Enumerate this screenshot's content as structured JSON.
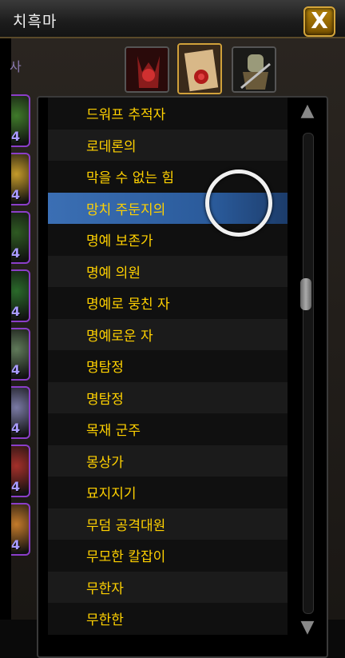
{
  "window": {
    "title": "치흑마",
    "close_label": "X"
  },
  "left_partial_char": "사",
  "slots": [
    {
      "num": "4",
      "color": "#3f7a2a"
    },
    {
      "num": "4",
      "color": "#c49a2a"
    },
    {
      "num": "4",
      "color": "#2e5a22"
    },
    {
      "num": "4",
      "color": "#2a6a2a"
    },
    {
      "num": "4",
      "color": "#607a5a"
    },
    {
      "num": "4",
      "color": "#7a7aa5"
    },
    {
      "num": "4",
      "color": "#a5302a"
    },
    {
      "num": "4",
      "color": "#c47a2a"
    }
  ],
  "tabs": [
    {
      "name": "tab-character",
      "color": "#6a1a1a",
      "active": false
    },
    {
      "name": "tab-titles",
      "color": "#c4a070",
      "active": true
    },
    {
      "name": "tab-equipment",
      "color": "#6a6a5a",
      "active": false
    }
  ],
  "titles": [
    "드워프 추적자",
    "로데론의",
    "막을 수 없는 힘",
    "망치 주둔지의",
    "명예 보존가",
    "명예 의원",
    "명예로 뭉친 자",
    "명예로운 자",
    "명탐정",
    "명탐정",
    "목재 군주",
    "몽상가",
    "묘지지기",
    "무덤 공격대원",
    "무모한 칼잡이",
    "무한자",
    "무한한"
  ],
  "selected_index": 3,
  "scroll": {
    "up_icon": "▲",
    "down_icon": "▼",
    "position": 0.32
  }
}
